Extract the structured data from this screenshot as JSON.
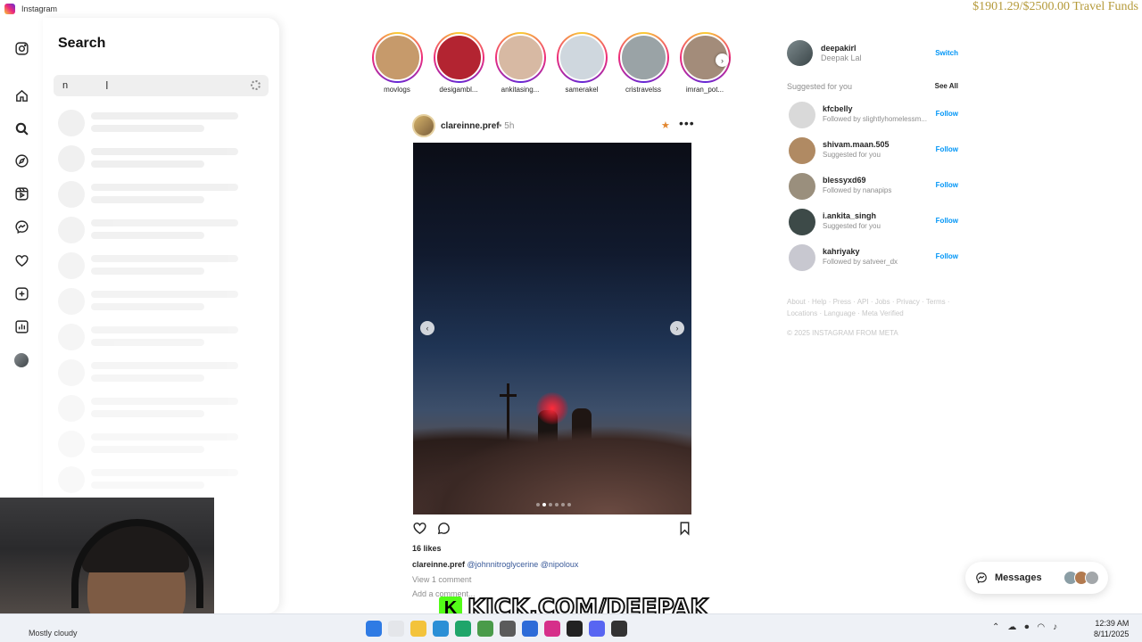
{
  "window": {
    "title": "Instagram"
  },
  "overlay": {
    "funds_text": "$1901.29/$2500.00 Travel Funds",
    "kick_url": "KICK.COM/DEEPAK",
    "kick_letter": "K"
  },
  "rail": {
    "icons": [
      "instagram-logo",
      "home",
      "search",
      "explore",
      "reels",
      "messenger",
      "heart",
      "create",
      "dashboard",
      "profile"
    ]
  },
  "search": {
    "title": "Search",
    "query": "n",
    "loading": true
  },
  "stories": [
    {
      "name": "movlogs",
      "color": "#c69a6b"
    },
    {
      "name": "desigambl...",
      "color": "#b32431"
    },
    {
      "name": "ankitasing...",
      "color": "#d7b9a3"
    },
    {
      "name": "samerakel",
      "color": "#cfd7de"
    },
    {
      "name": "cristravelss",
      "color": "#9aa3a6"
    },
    {
      "name": "imran_pot...",
      "color": "#a38c7a"
    }
  ],
  "post": {
    "username": "clareinne.pref",
    "time": "• 5h",
    "likes": "16 likes",
    "caption_user": "clareinne.pref",
    "caption_tags": "@johnnitroglycerine @nipoloux",
    "view_comments": "View 1 comment",
    "add_comment": "Add a comment...",
    "image_index": 1,
    "image_count": 6
  },
  "me": {
    "username": "deepakirl",
    "name": "Deepak Lal",
    "switch_label": "Switch"
  },
  "suggestions": {
    "heading": "Suggested for you",
    "see_all": "See All",
    "items": [
      {
        "username": "kfcbelly",
        "subtitle": "Followed by slightlyhomelessm...",
        "action": "Follow",
        "color": "#d9d9d9"
      },
      {
        "username": "shivam.maan.505",
        "subtitle": "Suggested for you",
        "action": "Follow",
        "color": "#b08a63"
      },
      {
        "username": "blessyxd69",
        "subtitle": "Followed by nanapips",
        "action": "Follow",
        "color": "#9a8f7d"
      },
      {
        "username": "i.ankita_singh",
        "subtitle": "Suggested for you",
        "action": "Follow",
        "color": "#3d4a48"
      },
      {
        "username": "kahriyaky",
        "subtitle": "Followed by satveer_dx",
        "action": "Follow",
        "color": "#c8c8d0"
      }
    ]
  },
  "footer": {
    "links": "About · Help · Press · API · Jobs · Privacy · Terms · Locations · Language · Meta Verified",
    "copyright": "© 2025 INSTAGRAM FROM META"
  },
  "messages": {
    "label": "Messages"
  },
  "taskbar": {
    "weather": "Mostly cloudy",
    "time": "12:39 AM",
    "date": "8/11/2025"
  }
}
